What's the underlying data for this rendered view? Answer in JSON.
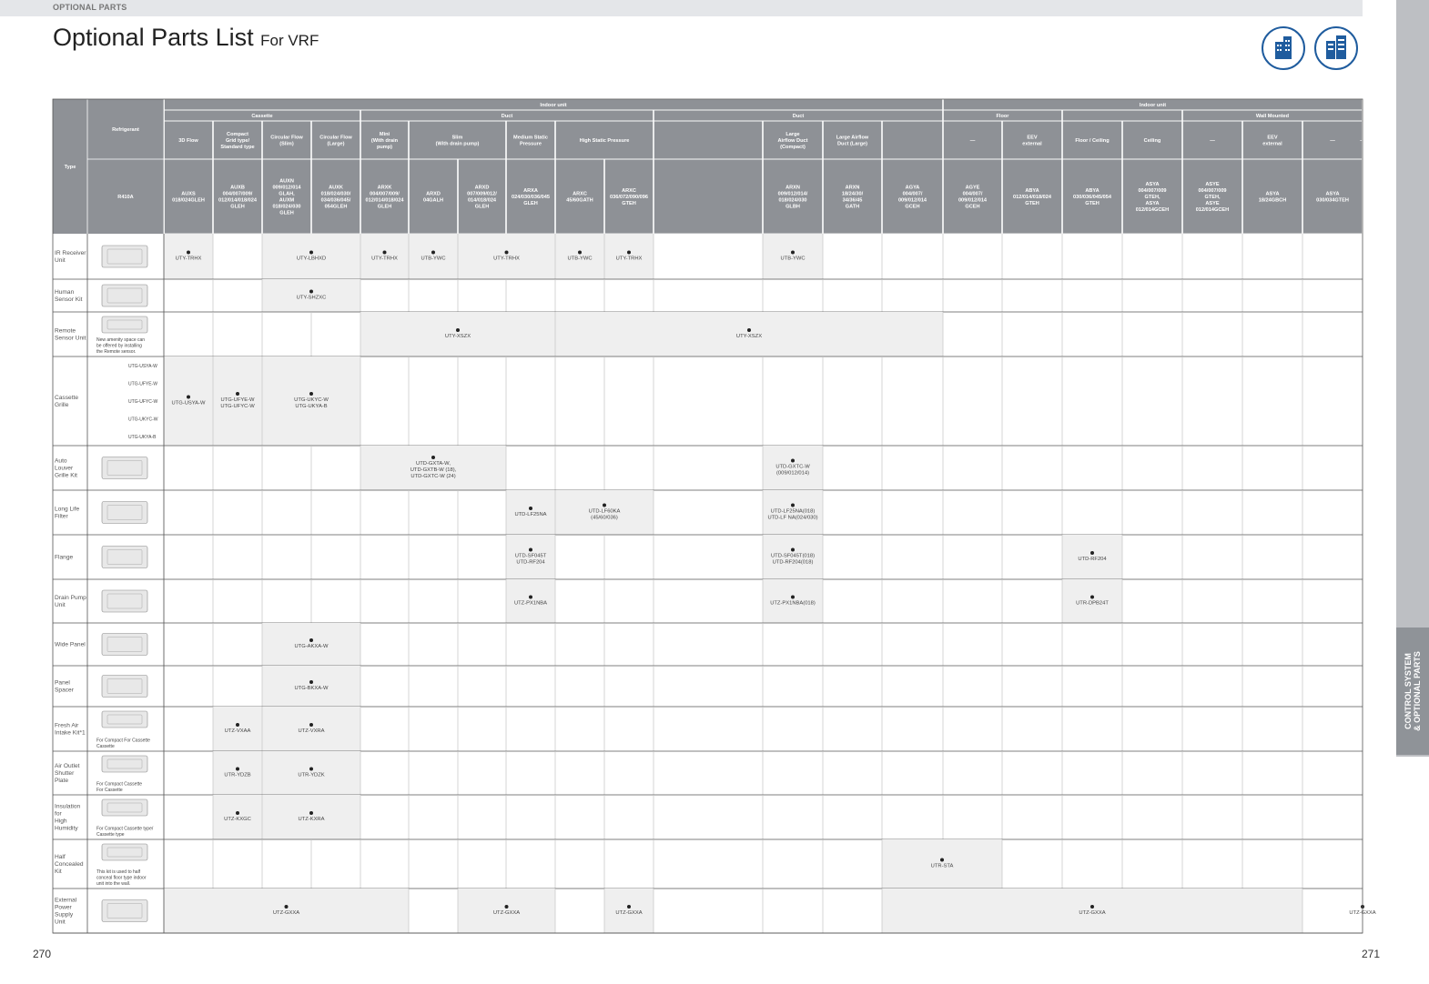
{
  "header": {
    "section_label": "OPTIONAL PARTS",
    "title": "Optional Parts List",
    "title_suffix": "For VRF"
  },
  "badges": [
    "building-icon",
    "building-icon"
  ],
  "sidebar": {
    "label_line1": "CONTROL SYSTEM",
    "label_line2": "& OPTIONAL PARTS"
  },
  "page_numbers": {
    "left": "270",
    "right": "271"
  },
  "table": {
    "type_label": "Type",
    "refrigerant_label": "Refrigerant",
    "refrigerant_value": "R410A",
    "groups1": [
      {
        "label": "Indoor unit",
        "c0": 2,
        "c1": 16
      },
      {
        "label": "Indoor unit",
        "c0": 16,
        "c1": 24
      }
    ],
    "groups2": [
      {
        "label": "Cassette",
        "c0": 2,
        "c1": 6
      },
      {
        "label": "Duct",
        "c0": 6,
        "c1": 12
      },
      {
        "label": "Duct",
        "c0": 12,
        "c1": 16
      },
      {
        "label": "Floor",
        "c0": 16,
        "c1": 18
      },
      {
        "label": "",
        "c0": 18,
        "c1": 20
      },
      {
        "label": "Wall Mounted",
        "c0": 20,
        "c1": 24
      }
    ],
    "groups3": [
      {
        "label": [
          "3D Flow"
        ],
        "c0": 2,
        "c1": 3
      },
      {
        "label": [
          "Compact",
          "Grid type/",
          "Standard type"
        ],
        "c0": 3,
        "c1": 4
      },
      {
        "label": [
          "Circular Flow",
          "(Slim)"
        ],
        "c0": 4,
        "c1": 5
      },
      {
        "label": [
          "Circular Flow",
          "(Large)"
        ],
        "c0": 5,
        "c1": 6
      },
      {
        "label": [
          "Mini",
          "(With drain",
          "pump)"
        ],
        "c0": 6,
        "c1": 7
      },
      {
        "label": [
          "Slim",
          "(With drain pump)"
        ],
        "c0": 7,
        "c1": 9
      },
      {
        "label": [
          "Medium Static",
          "Pressure"
        ],
        "c0": 9,
        "c1": 10
      },
      {
        "label": [
          "High Static Pressure"
        ],
        "c0": 10,
        "c1": 12
      },
      {
        "label": [],
        "c0": 12,
        "c1": 13
      },
      {
        "label": [
          "Large",
          "Airflow Duct",
          "(Compact)"
        ],
        "c0": 13,
        "c1": 14
      },
      {
        "label": [
          "Large Airflow",
          "Duct (Large)"
        ],
        "c0": 14,
        "c1": 15
      },
      {
        "label": [],
        "c0": 15,
        "c1": 16
      },
      {
        "label": [
          "—"
        ],
        "c0": 16,
        "c1": 17
      },
      {
        "label": [
          "EEV",
          "external"
        ],
        "c0": 17,
        "c1": 18
      },
      {
        "label": [
          "Floor / Ceiling"
        ],
        "c0": 18,
        "c1": 19
      },
      {
        "label": [
          "Ceiling"
        ],
        "c0": 19,
        "c1": 20
      },
      {
        "label": [
          "—"
        ],
        "c0": 20,
        "c1": 21
      },
      {
        "label": [
          "EEV",
          "external"
        ],
        "c0": 21,
        "c1": 22
      },
      {
        "label": [
          "—"
        ],
        "c0": 22,
        "c1": 23
      },
      {
        "label": [
          "—"
        ],
        "c0": 23,
        "c1": 24
      }
    ],
    "models": [
      {
        "label": [
          "AUXS",
          "018/024GLEH"
        ],
        "c0": 2,
        "c1": 3
      },
      {
        "label": [
          "AUXB",
          "004/007/009/",
          "012/014/018/024",
          "GLEH"
        ],
        "c0": 3,
        "c1": 4
      },
      {
        "label": [
          "AUXN",
          "009/012/014",
          "GLAH,",
          "AUXM",
          "018/024/030",
          "GLEH"
        ],
        "c0": 4,
        "c1": 5
      },
      {
        "label": [
          "AUXK",
          "018/024/030/",
          "034/036/045/",
          "054GLEH"
        ],
        "c0": 5,
        "c1": 6
      },
      {
        "label": [
          "ARXK",
          "004/007/009/",
          "012/014/018/024",
          "GLEH"
        ],
        "c0": 6,
        "c1": 7
      },
      {
        "label": [
          "ARXD",
          "04GALH"
        ],
        "c0": 7,
        "c1": 8
      },
      {
        "label": [
          "ARXD",
          "007/009/012/",
          "014/018/024",
          "GLEH"
        ],
        "c0": 8,
        "c1": 9
      },
      {
        "label": [
          "ARXA",
          "024/030/036/045",
          "GLEH"
        ],
        "c0": 9,
        "c1": 10
      },
      {
        "label": [
          "ARXC",
          "45/60GATH"
        ],
        "c0": 10,
        "c1": 11
      },
      {
        "label": [
          "ARXC",
          "036/072/090/096",
          "GTEH"
        ],
        "c0": 11,
        "c1": 12
      },
      {
        "label": [],
        "c0": 12,
        "c1": 13
      },
      {
        "label": [
          "ARXN",
          "009/012/014/",
          "018/024/030",
          "GLBH"
        ],
        "c0": 13,
        "c1": 14
      },
      {
        "label": [
          "ARXN",
          "18/24/30/",
          "34/36/45",
          "GATH"
        ],
        "c0": 14,
        "c1": 15
      },
      {
        "label": [
          "AGYA",
          "004/007/",
          "009/012/014",
          "GCEH"
        ],
        "c0": 15,
        "c1": 16
      },
      {
        "label": [
          "AGYE",
          "004/007/",
          "009/012/014",
          "GCEH"
        ],
        "c0": 16,
        "c1": 17
      },
      {
        "label": [
          "ABYA",
          "012/014/018/024",
          "GTEH"
        ],
        "c0": 17,
        "c1": 18
      },
      {
        "label": [
          "ABYA",
          "030/036/045/054",
          "GTEH"
        ],
        "c0": 18,
        "c1": 19
      },
      {
        "label": [
          "ASYA",
          "004/007/009",
          "GTEH,",
          "ASYA",
          "012/014GCEH"
        ],
        "c0": 19,
        "c1": 20
      },
      {
        "label": [
          "ASYE",
          "004/007/009",
          "GTEH,",
          "ASYE",
          "012/014GCEH"
        ],
        "c0": 20,
        "c1": 21
      },
      {
        "label": [
          "ASYA",
          "18/24GBCH"
        ],
        "c0": 21,
        "c1": 22
      },
      {
        "label": [
          "ASYA",
          "030/034GTEH"
        ],
        "c0": 22,
        "c1": 23
      }
    ],
    "rows": [
      {
        "type": [
          "IR Receiver",
          "Unit"
        ],
        "icon": "ir-receiver-icon",
        "note": [],
        "subs": [],
        "cells": [
          {
            "c0": 2,
            "c1": 3,
            "text": [
              "UTY-TRHX"
            ],
            "shade": true
          },
          {
            "c0": 4,
            "c1": 6,
            "text": [
              "UTY-LBHXD"
            ],
            "shade": true
          },
          {
            "c0": 6,
            "c1": 7,
            "text": [
              "UTY-TRHX"
            ],
            "shade": true
          },
          {
            "c0": 7,
            "c1": 8,
            "text": [
              "UTB-YWC"
            ],
            "shade": true
          },
          {
            "c0": 8,
            "c1": 10,
            "text": [
              "UTY-TRHX"
            ],
            "shade": true
          },
          {
            "c0": 10,
            "c1": 11,
            "text": [
              "UTB-YWC"
            ],
            "shade": true
          },
          {
            "c0": 11,
            "c1": 12,
            "text": [
              "UTY-TRHX"
            ],
            "shade": true
          },
          {
            "c0": 13,
            "c1": 14,
            "text": [
              "UTB-YWC"
            ],
            "shade": true
          }
        ]
      },
      {
        "type": [
          "Human",
          "Sensor Kit"
        ],
        "icon": "human-sensor-icon",
        "note": [],
        "subs": [],
        "cells": [
          {
            "c0": 4,
            "c1": 6,
            "text": [
              "UTY-SHZXC"
            ],
            "shade": true
          }
        ]
      },
      {
        "type": [
          "Remote",
          "Sensor Unit"
        ],
        "icon": "remote-sensor-icon",
        "note": [
          "New amenity space can",
          "be offered by installing",
          "the Remote sensor."
        ],
        "subs": [],
        "cells": [
          {
            "c0": 6,
            "c1": 10,
            "text": [
              "UTY-XSZX"
            ],
            "shade": true
          },
          {
            "c0": 10,
            "c1": 16,
            "text": [
              "UTY-XSZX"
            ],
            "shade": true
          }
        ]
      },
      {
        "type": [
          "Cassette",
          "Grille"
        ],
        "icon": "cassette-grille-icon",
        "note": [],
        "subs": [
          "UTG-USYA-W",
          "UTG-UFYE-W",
          "UTG-UFYC-W",
          "UTG-UKYC-W",
          "UTG-UKYA-B"
        ],
        "cells": [
          {
            "c0": 2,
            "c1": 3,
            "text": [
              "UTG-USYA-W"
            ],
            "shade": true
          },
          {
            "c0": 3,
            "c1": 4,
            "text": [
              "UTG-UFYE-W",
              "UTG-UFYC-W"
            ],
            "shade": true
          },
          {
            "c0": 4,
            "c1": 6,
            "text": [
              "UTG-UKYC-W",
              "UTG-UKYA-B"
            ],
            "shade": true
          }
        ]
      },
      {
        "type": [
          "Auto",
          "Louver",
          "Grille Kit"
        ],
        "icon": "louver-grille-icon",
        "note": [],
        "subs": [],
        "cells": [
          {
            "c0": 6,
            "c1": 9,
            "text": [
              "UTD-GXTA-W,",
              "UTD-GXTB-W (18),",
              "UTD-GXTC-W (24)"
            ],
            "shade": true
          },
          {
            "c0": 13,
            "c1": 14,
            "text": [
              "UTD-GXTC-W",
              "(009/012/014)"
            ],
            "shade": true
          }
        ]
      },
      {
        "type": [
          "Long Life",
          "Filter"
        ],
        "icon": "filter-icon",
        "note": [],
        "subs": [],
        "cells": [
          {
            "c0": 9,
            "c1": 10,
            "text": [
              "UTD-LF25NA"
            ],
            "shade": true
          },
          {
            "c0": 10,
            "c1": 12,
            "text": [
              "UTD-LF60KA",
              "(45/60/036)"
            ],
            "shade": true
          },
          {
            "c0": 13,
            "c1": 14,
            "text": [
              "UTD-LF25NA(018)",
              "UTD-LF NA(024/030)"
            ],
            "shade": true
          }
        ]
      },
      {
        "type": [
          "Flange"
        ],
        "icon": "flange-icon",
        "note": [],
        "subs": [],
        "cells": [
          {
            "c0": 9,
            "c1": 10,
            "text": [
              "UTD-SF045T",
              "UTD-RF204"
            ],
            "shade": true
          },
          {
            "c0": 13,
            "c1": 14,
            "text": [
              "UTD-SF045T(018)",
              "UTD-RF204(018)"
            ],
            "shade": true
          },
          {
            "c0": 18,
            "c1": 19,
            "text": [
              "UTD-RF204"
            ],
            "shade": true
          }
        ]
      },
      {
        "type": [
          "Drain Pump",
          "Unit"
        ],
        "icon": "drain-pump-icon",
        "note": [],
        "subs": [],
        "cells": [
          {
            "c0": 9,
            "c1": 10,
            "text": [
              "UTZ-PX1NBA"
            ],
            "shade": true
          },
          {
            "c0": 13,
            "c1": 14,
            "text": [
              "UTZ-PX1NBA(018)"
            ],
            "shade": true
          },
          {
            "c0": 18,
            "c1": 19,
            "text": [
              "UTR-DPB24T"
            ],
            "shade": true
          }
        ]
      },
      {
        "type": [
          "Wide Panel"
        ],
        "icon": "wide-panel-icon",
        "note": [],
        "subs": [],
        "cells": [
          {
            "c0": 4,
            "c1": 6,
            "text": [
              "UTG-AKXA-W"
            ],
            "shade": true
          }
        ]
      },
      {
        "type": [
          "Panel",
          "Spacer"
        ],
        "icon": "panel-spacer-icon",
        "note": [],
        "subs": [],
        "cells": [
          {
            "c0": 4,
            "c1": 6,
            "text": [
              "UTG-BKXA-W"
            ],
            "shade": true
          }
        ]
      },
      {
        "type": [
          "Fresh Air",
          "Intake Kit*1"
        ],
        "icon": "fresh-air-kit-icon",
        "note": [
          "For Compact   For Cassette",
          "Cassette"
        ],
        "subs": [],
        "cells": [
          {
            "c0": 3,
            "c1": 4,
            "text": [
              "UTZ-VXAA"
            ],
            "shade": true
          },
          {
            "c0": 4,
            "c1": 6,
            "text": [
              "UTZ-VXRA"
            ],
            "shade": true
          }
        ]
      },
      {
        "type": [
          "Air Outlet",
          "Shutter",
          "Plate"
        ],
        "icon": "shutter-plate-icon",
        "note": [
          "For Compact Cassette",
          "For Cassette"
        ],
        "subs": [],
        "cells": [
          {
            "c0": 3,
            "c1": 4,
            "text": [
              "UTR-YDZB"
            ],
            "shade": true
          },
          {
            "c0": 4,
            "c1": 6,
            "text": [
              "UTR-YDZK"
            ],
            "shade": true
          }
        ]
      },
      {
        "type": [
          "Insulation",
          "for",
          "High",
          "Humidity"
        ],
        "icon": "insulation-icon",
        "note": [
          "For Compact Cassette type/",
          "Cassette type"
        ],
        "subs": [],
        "cells": [
          {
            "c0": 3,
            "c1": 4,
            "text": [
              "UTZ-KXGC"
            ],
            "shade": true
          },
          {
            "c0": 4,
            "c1": 6,
            "text": [
              "UTZ-KXRA"
            ],
            "shade": true
          }
        ]
      },
      {
        "type": [
          "Half",
          "Concealed",
          "Kit"
        ],
        "icon": "half-concealed-kit-icon",
        "note": [
          "This kit is used to half",
          "conceal floor type indoor",
          "unit into the wall."
        ],
        "subs": [],
        "cells": [
          {
            "c0": 15,
            "c1": 17,
            "text": [
              "UTR-STA"
            ],
            "shade": true
          }
        ]
      },
      {
        "type": [
          "External",
          "Power",
          "Supply",
          "Unit"
        ],
        "icon": "power-supply-icon",
        "note": [],
        "subs": [],
        "cells": [
          {
            "c0": 2,
            "c1": 7,
            "text": [
              "UTZ-GXXA"
            ],
            "shade": true
          },
          {
            "c0": 8,
            "c1": 10,
            "text": [
              "UTZ-GXXA"
            ],
            "shade": true
          },
          {
            "c0": 11,
            "c1": 12,
            "text": [
              "UTZ-GXXA"
            ],
            "shade": true
          },
          {
            "c0": 15,
            "c1": 22,
            "text": [
              "UTZ-GXXA"
            ],
            "shade": true
          },
          {
            "c0": 23,
            "c1": 24,
            "text": [
              "UTZ-GXXA"
            ],
            "shade": true
          }
        ]
      }
    ]
  }
}
